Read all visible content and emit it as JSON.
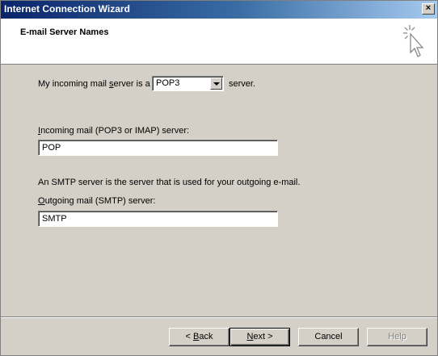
{
  "window": {
    "title": "Internet Connection Wizard",
    "close_symbol": "×"
  },
  "header": {
    "title": "E-mail Server Names",
    "icon": "wizard-cursor-sparkle-icon"
  },
  "form": {
    "incoming_type_prefix": "My incoming mail ",
    "incoming_type_accel": "s",
    "incoming_type_mid": "erver is a",
    "incoming_type_selected": "POP3",
    "incoming_type_suffix": "server.",
    "incoming_label_accel": "I",
    "incoming_label_rest": "ncoming mail (POP3 or IMAP) server:",
    "incoming_value": "POP",
    "smtp_info": "An SMTP server is the server that is used for your outgoing e-mail.",
    "outgoing_label_accel": "O",
    "outgoing_label_rest": "utgoing mail (SMTP) server:",
    "outgoing_value": "SMTP"
  },
  "buttons": {
    "back_prefix": "< ",
    "back_accel": "B",
    "back_rest": "ack",
    "next_accel": "N",
    "next_rest": "ext >",
    "cancel": "Cancel",
    "help": "Help"
  }
}
